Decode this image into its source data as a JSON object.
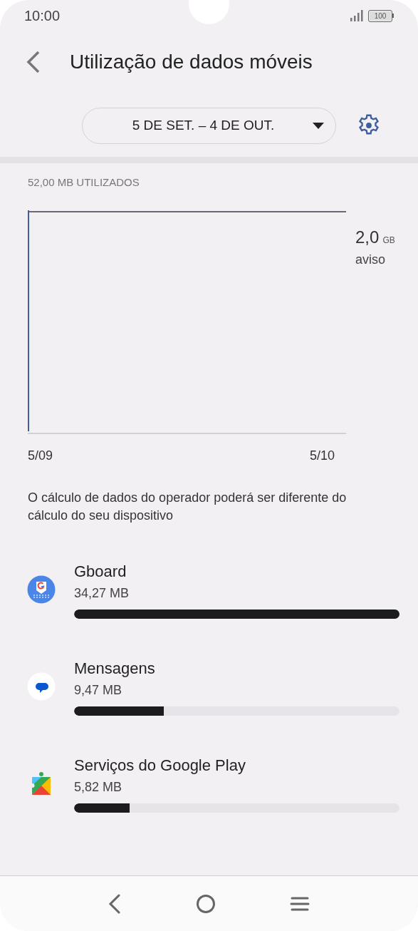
{
  "status_bar": {
    "time": "10:00",
    "battery": "100"
  },
  "header": {
    "title": "Utilização de dados móveis"
  },
  "cycle_selector": {
    "value": "5 DE SET. – 4 DE OUT."
  },
  "usage": {
    "total": "52,00 MB UTILIZADOS",
    "warning_value": "2,0",
    "warning_unit": "GB",
    "warning_label": "aviso",
    "x_start": "5/09",
    "x_end": "5/10"
  },
  "note": "O cálculo de dados do operador poderá ser diferente do cálculo do seu dispositivo",
  "apps": [
    {
      "kind": "keyboard",
      "name": "Gboard",
      "size": "34,27 MB",
      "level": 1.0
    },
    {
      "kind": "messages",
      "name": "Mensagens",
      "size": "9,47 MB",
      "level": 0.276
    },
    {
      "kind": "play",
      "name": "Serviços do Google Play",
      "size": "5,82 MB",
      "level": 0.17
    }
  ]
}
